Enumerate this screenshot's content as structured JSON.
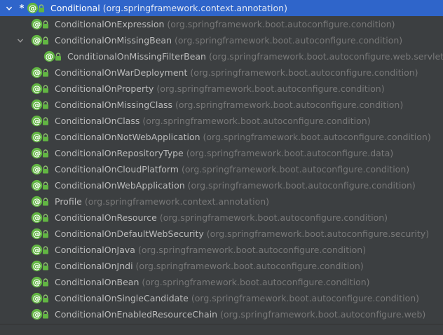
{
  "tree": {
    "root": {
      "name": "Conditional",
      "package": "(org.springframework.context.annotation)",
      "marker": "*",
      "expanded": true,
      "selected": true
    },
    "items": [
      {
        "name": "ConditionalOnExpression",
        "package": "(org.springframework.boot.autoconfigure.condition)",
        "depth": 1
      },
      {
        "name": "ConditionalOnMissingBean",
        "package": "(org.springframework.boot.autoconfigure.condition)",
        "depth": 1,
        "expanded": true
      },
      {
        "name": "ConditionalOnMissingFilterBean",
        "package": "(org.springframework.boot.autoconfigure.web.servlet)",
        "depth": 2
      },
      {
        "name": "ConditionalOnWarDeployment",
        "package": "(org.springframework.boot.autoconfigure.condition)",
        "depth": 1
      },
      {
        "name": "ConditionalOnProperty",
        "package": "(org.springframework.boot.autoconfigure.condition)",
        "depth": 1
      },
      {
        "name": "ConditionalOnMissingClass",
        "package": "(org.springframework.boot.autoconfigure.condition)",
        "depth": 1
      },
      {
        "name": "ConditionalOnClass",
        "package": "(org.springframework.boot.autoconfigure.condition)",
        "depth": 1
      },
      {
        "name": "ConditionalOnNotWebApplication",
        "package": "(org.springframework.boot.autoconfigure.condition)",
        "depth": 1
      },
      {
        "name": "ConditionalOnRepositoryType",
        "package": "(org.springframework.boot.autoconfigure.data)",
        "depth": 1
      },
      {
        "name": "ConditionalOnCloudPlatform",
        "package": "(org.springframework.boot.autoconfigure.condition)",
        "depth": 1
      },
      {
        "name": "ConditionalOnWebApplication",
        "package": "(org.springframework.boot.autoconfigure.condition)",
        "depth": 1
      },
      {
        "name": "Profile",
        "package": "(org.springframework.context.annotation)",
        "depth": 1
      },
      {
        "name": "ConditionalOnResource",
        "package": "(org.springframework.boot.autoconfigure.condition)",
        "depth": 1
      },
      {
        "name": "ConditionalOnDefaultWebSecurity",
        "package": "(org.springframework.boot.autoconfigure.security)",
        "depth": 1
      },
      {
        "name": "ConditionalOnJava",
        "package": "(org.springframework.boot.autoconfigure.condition)",
        "depth": 1
      },
      {
        "name": "ConditionalOnJndi",
        "package": "(org.springframework.boot.autoconfigure.condition)",
        "depth": 1
      },
      {
        "name": "ConditionalOnBean",
        "package": "(org.springframework.boot.autoconfigure.condition)",
        "depth": 1
      },
      {
        "name": "ConditionalOnSingleCandidate",
        "package": "(org.springframework.boot.autoconfigure.condition)",
        "depth": 1
      },
      {
        "name": "ConditionalOnEnabledResourceChain",
        "package": "(org.springframework.boot.autoconfigure.web)",
        "depth": 1
      }
    ]
  },
  "icons": {
    "annotation": "annotation-type-icon",
    "lock": "lock-icon",
    "expand": "chevron-down-icon"
  },
  "colors": {
    "background": "#3c3f41",
    "selection": "#2f65ca",
    "name_text": "#bbbbbb",
    "package_text": "#787878",
    "icon_green": "#62b543"
  }
}
